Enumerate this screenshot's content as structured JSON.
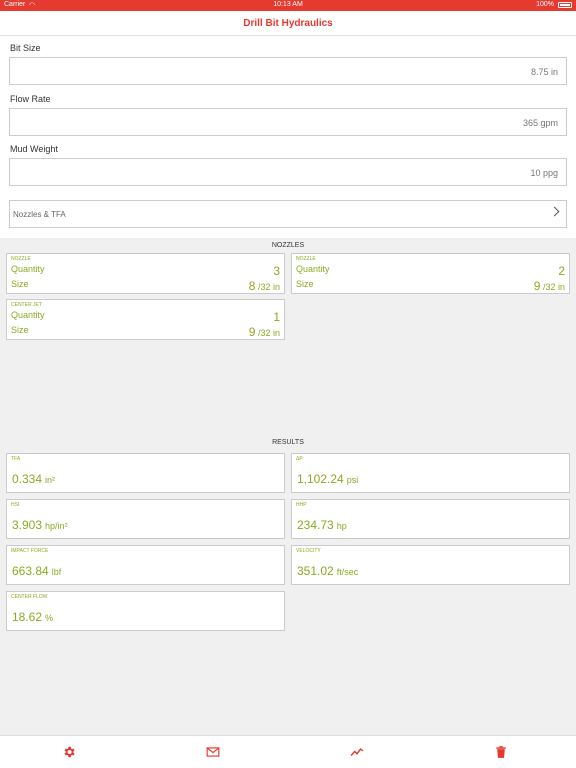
{
  "status": {
    "carrier": "Carrier",
    "time": "10:13 AM",
    "battery": "100%"
  },
  "nav": {
    "title": "Drill Bit Hydraulics"
  },
  "form": {
    "bit_size": {
      "label": "Bit Size",
      "value": "8.75 in"
    },
    "flow_rate": {
      "label": "Flow Rate",
      "value": "365 gpm"
    },
    "mud_weight": {
      "label": "Mud Weight",
      "value": "10 ppg"
    },
    "nozzles_link": "Nozzles & TFA"
  },
  "nozzles": {
    "header": "NOZZLES",
    "cards": [
      {
        "caption": "NOZZLE",
        "qty_label": "Quantity",
        "qty": "3",
        "size_label": "Size",
        "size": "8",
        "size_unit": "/32 in"
      },
      {
        "caption": "NOZZLE",
        "qty_label": "Quantity",
        "qty": "2",
        "size_label": "Size",
        "size": "9",
        "size_unit": "/32 in"
      },
      {
        "caption": "CENTER JET",
        "qty_label": "Quantity",
        "qty": "1",
        "size_label": "Size",
        "size": "9",
        "size_unit": "/32 in"
      }
    ]
  },
  "results": {
    "header": "RESULTS",
    "cards": [
      {
        "caption": "TFA",
        "value": "0.334",
        "unit": "in²"
      },
      {
        "caption": "ΔP",
        "value": "1,102.24",
        "unit": "psi"
      },
      {
        "caption": "HSI",
        "value": "3.903",
        "unit": "hp/in²"
      },
      {
        "caption": "HHP",
        "value": "234.73",
        "unit": "hp"
      },
      {
        "caption": "IMPACT FORCE",
        "value": "663.84",
        "unit": "lbf"
      },
      {
        "caption": "VELOCITY",
        "value": "351.02",
        "unit": "ft/sec"
      },
      {
        "caption": "CENTER FLOW",
        "value": "18.62",
        "unit": "%"
      }
    ]
  },
  "tabbar": {
    "icons": [
      "gear-icon",
      "mail-icon",
      "chart-icon",
      "trash-icon"
    ],
    "accent": "#e53a2f"
  },
  "colors": {
    "accent": "#e53a2f",
    "value_green": "#8aaa22"
  }
}
